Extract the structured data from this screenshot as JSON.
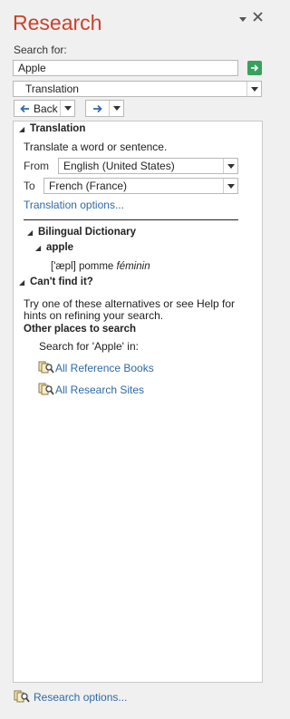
{
  "header": {
    "title": "Research",
    "menu_icon": "dropdown-arrow-icon",
    "close_icon": "close-icon"
  },
  "search": {
    "label": "Search for:",
    "value": "Apple",
    "service": "Translation"
  },
  "nav": {
    "back_label": "Back"
  },
  "translation": {
    "heading": "Translation",
    "description": "Translate a word or sentence.",
    "from_label": "From",
    "from_value": "English (United States)",
    "to_label": "To",
    "to_value": "French (France)",
    "options_link": "Translation options..."
  },
  "dictionary": {
    "heading": "Bilingual Dictionary",
    "word": "apple",
    "pronunciation": "['æpl] pomme",
    "gender": "féminin"
  },
  "cant_find": {
    "heading": "Can't find it?",
    "hint": "Try one of these alternatives or see Help for hints on refining your search.",
    "other_places": "Other places to search",
    "search_for": "Search for 'Apple' in:",
    "links": [
      "All Reference Books",
      "All Research Sites"
    ]
  },
  "footer": {
    "options_link": "Research options..."
  },
  "colors": {
    "title": "#c8432a",
    "link": "#2e6aa8",
    "go_button": "#37a15d"
  }
}
